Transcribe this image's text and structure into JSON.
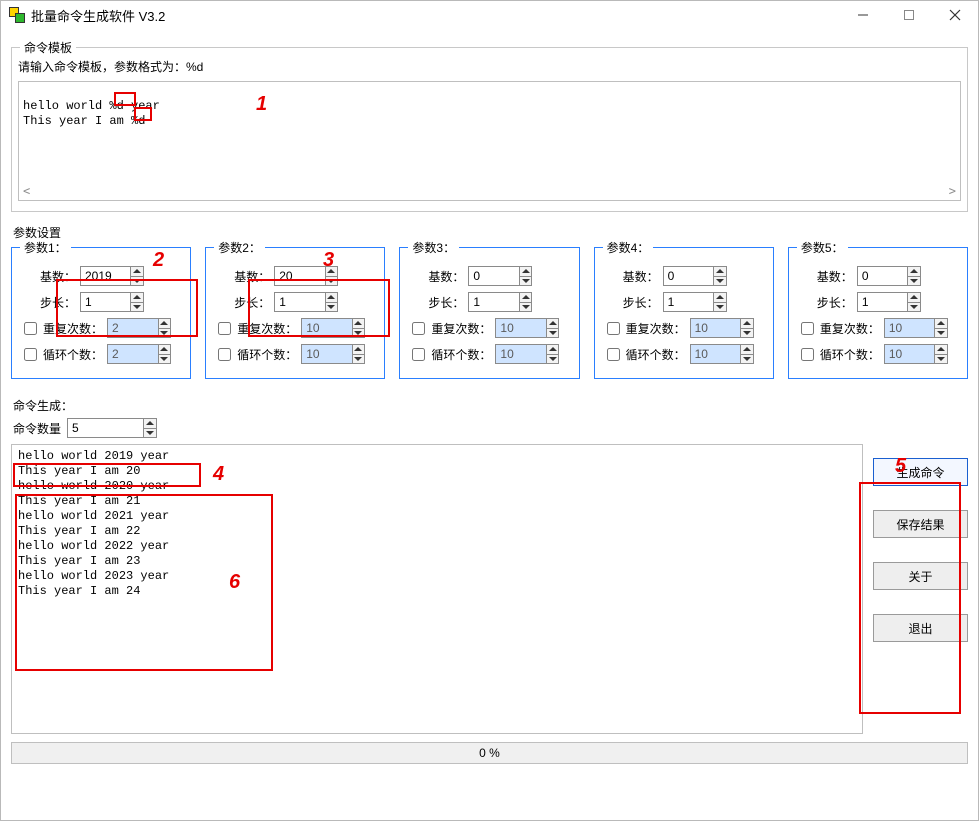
{
  "window": {
    "title": "批量命令生成软件 V3.2"
  },
  "template": {
    "group_label": "命令模板",
    "hint": "请输入命令模板，参数格式为：%d",
    "line1_a": "hello world ",
    "line1_b": "%d ",
    "line1_c": "year",
    "line2_a": "This year I am ",
    "line2_b": "%d",
    "scroll_left": "<",
    "scroll_right": ">"
  },
  "params": {
    "section_label": "参数设置",
    "labels": {
      "base": "基数：",
      "step": "步长：",
      "repeat": "重复次数：",
      "loop": "循环个数："
    },
    "groups": [
      {
        "legend": "参数1：",
        "base": "2019",
        "step": "1",
        "repeat_en": false,
        "repeat": "2",
        "loop_en": false,
        "loop": "2"
      },
      {
        "legend": "参数2：",
        "base": "20",
        "step": "1",
        "repeat_en": false,
        "repeat": "10",
        "loop_en": false,
        "loop": "10"
      },
      {
        "legend": "参数3：",
        "base": "0",
        "step": "1",
        "repeat_en": false,
        "repeat": "10",
        "loop_en": false,
        "loop": "10"
      },
      {
        "legend": "参数4：",
        "base": "0",
        "step": "1",
        "repeat_en": false,
        "repeat": "10",
        "loop_en": false,
        "loop": "10"
      },
      {
        "legend": "参数5：",
        "base": "0",
        "step": "1",
        "repeat_en": false,
        "repeat": "10",
        "loop_en": false,
        "loop": "10"
      }
    ]
  },
  "generate": {
    "section_label": "命令生成：",
    "count_label": "命令数量",
    "count_value": "5",
    "output": "hello world 2019 year\nThis year I am 20\nhello world 2020 year\nThis year I am 21\nhello world 2021 year\nThis year I am 22\nhello world 2022 year\nThis year I am 23\nhello world 2023 year\nThis year I am 24",
    "progress": "0 %"
  },
  "buttons": {
    "generate": "生成命令",
    "save": "保存结果",
    "about": "关于",
    "exit": "退出"
  },
  "annotations": {
    "n1": "1",
    "n2": "2",
    "n3": "3",
    "n4": "4",
    "n5": "5",
    "n6": "6"
  }
}
